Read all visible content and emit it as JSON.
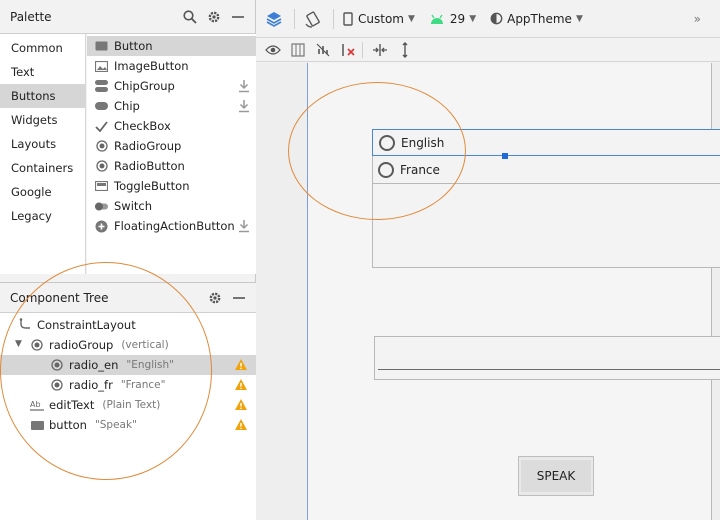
{
  "palette": {
    "title": "Palette",
    "categories": [
      "Common",
      "Text",
      "Buttons",
      "Widgets",
      "Layouts",
      "Containers",
      "Google",
      "Legacy"
    ],
    "selected_category": "Buttons",
    "widgets": [
      {
        "label": "Button",
        "icon": "button-icon",
        "download": false
      },
      {
        "label": "ImageButton",
        "icon": "image-icon",
        "download": false
      },
      {
        "label": "ChipGroup",
        "icon": "chip-group-icon",
        "download": true
      },
      {
        "label": "Chip",
        "icon": "chip-icon",
        "download": true
      },
      {
        "label": "CheckBox",
        "icon": "checkmark-icon",
        "download": false
      },
      {
        "label": "RadioGroup",
        "icon": "radio-icon",
        "download": false
      },
      {
        "label": "RadioButton",
        "icon": "radio-icon",
        "download": false
      },
      {
        "label": "ToggleButton",
        "icon": "toggle-icon",
        "download": false
      },
      {
        "label": "Switch",
        "icon": "switch-icon",
        "download": false
      },
      {
        "label": "FloatingActionButton",
        "icon": "plus-circle-icon",
        "download": true
      }
    ]
  },
  "tree": {
    "title": "Component Tree",
    "rows": [
      {
        "name": "ConstraintLayout",
        "sub": "",
        "warn": false
      },
      {
        "name": "radioGroup",
        "sub": "(vertical)",
        "warn": false
      },
      {
        "name": "radio_en",
        "sub": "\"English\"",
        "warn": true
      },
      {
        "name": "radio_fr",
        "sub": "\"France\"",
        "warn": true
      },
      {
        "name": "editText",
        "sub": "(Plain Text)",
        "warn": true
      },
      {
        "name": "button",
        "sub": "\"Speak\"",
        "warn": true
      }
    ]
  },
  "toolbar": {
    "device": "Custom",
    "api": "29",
    "theme": "AppTheme",
    "more": "»"
  },
  "design": {
    "radio_en_label": "English",
    "radio_fr_label": "France",
    "button_label": "SPEAK"
  },
  "colors": {
    "accent": "#1e6ad6",
    "warning": "#f0a30a",
    "android_green": "#3ddc84",
    "annotation": "#e08a3a"
  }
}
